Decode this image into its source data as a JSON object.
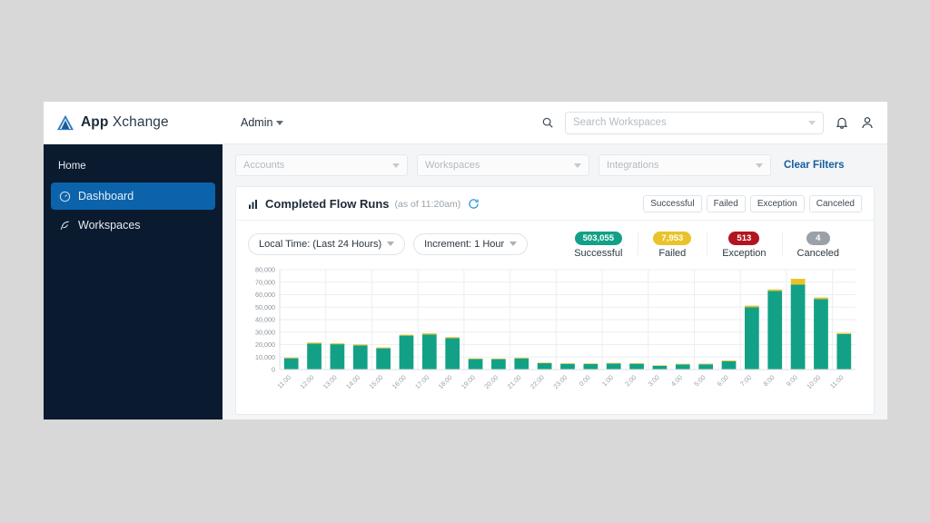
{
  "brand": {
    "name_bold": "App",
    "name_light": "Xchange",
    "logo_icon": "triangle-logo-icon",
    "accent_blue": "#0b63ab",
    "sidebar_bg": "#0a1a2f"
  },
  "topbar": {
    "admin_label": "Admin",
    "admin_caret_icon": "chevron-down-icon",
    "search_icon": "search-icon",
    "search_placeholder": "Search Workspaces",
    "search_value": "",
    "search_caret_icon": "chevron-down-icon",
    "notifications_icon": "bell-icon",
    "account_icon": "user-icon"
  },
  "sidebar": {
    "home_label": "Home",
    "items": [
      {
        "label": "Dashboard",
        "icon": "gauge-icon",
        "active": true
      },
      {
        "label": "Workspaces",
        "icon": "feather-icon",
        "active": false
      }
    ]
  },
  "filters": {
    "selects": [
      {
        "placeholder": "Accounts",
        "value": "",
        "icon": "chevron-down-icon"
      },
      {
        "placeholder": "Workspaces",
        "value": "",
        "icon": "chevron-down-icon"
      },
      {
        "placeholder": "Integrations",
        "value": "",
        "icon": "chevron-down-icon"
      }
    ],
    "clear_label": "Clear Filters"
  },
  "card": {
    "icon": "bar-chart-icon",
    "title": "Completed Flow Runs",
    "subtitle": "(as of 11:20am)",
    "refresh_icon": "refresh-icon",
    "legend_buttons": [
      "Successful",
      "Failed",
      "Exception",
      "Canceled"
    ],
    "controls": [
      {
        "label": "Local Time: (Last 24 Hours)",
        "icon": "chevron-down-icon"
      },
      {
        "label": "Increment: 1 Hour",
        "icon": "chevron-down-icon"
      }
    ],
    "stats": [
      {
        "value": "503,055",
        "label": "Successful",
        "color": "#12a186"
      },
      {
        "value": "7,953",
        "label": "Failed",
        "color": "#e9c32a"
      },
      {
        "value": "513",
        "label": "Exception",
        "color": "#b3141f"
      },
      {
        "value": "4",
        "label": "Canceled",
        "color": "#9aa1a8"
      }
    ]
  },
  "chart_data": {
    "type": "bar",
    "title": "Completed Flow Runs",
    "stacked": true,
    "xlabel": "",
    "ylabel": "",
    "ylim": [
      0,
      80000
    ],
    "yticks": [
      0,
      10000,
      20000,
      30000,
      40000,
      50000,
      60000,
      70000,
      80000
    ],
    "ytick_labels": [
      "0",
      "10,000",
      "20,000",
      "30,000",
      "40,000",
      "50,000",
      "60,000",
      "70,000",
      "80,000"
    ],
    "grid": true,
    "legend_position": "top-right",
    "categories": [
      "11:00",
      "12:00",
      "13:00",
      "14:00",
      "15:00",
      "16:00",
      "17:00",
      "18:00",
      "19:00",
      "20:00",
      "21:00",
      "22:00",
      "23:00",
      "0:00",
      "1:00",
      "2:00",
      "3:00",
      "4:00",
      "5:00",
      "6:00",
      "7:00",
      "8:00",
      "9:00",
      "10:00",
      "11:00"
    ],
    "series": [
      {
        "name": "Successful",
        "color": "#12a186",
        "values": [
          9000,
          20800,
          20300,
          19400,
          17000,
          27200,
          28100,
          25200,
          8400,
          8300,
          8900,
          5100,
          4600,
          4500,
          4800,
          4600,
          3000,
          4100,
          4200,
          6700,
          50000,
          63000,
          68000,
          56500,
          28400
        ]
      },
      {
        "name": "Failed",
        "color": "#e9c32a",
        "values": [
          600,
          800,
          700,
          700,
          700,
          700,
          900,
          800,
          500,
          500,
          600,
          400,
          400,
          400,
          500,
          500,
          400,
          500,
          500,
          600,
          1200,
          1200,
          4700,
          1200,
          900
        ]
      }
    ]
  }
}
